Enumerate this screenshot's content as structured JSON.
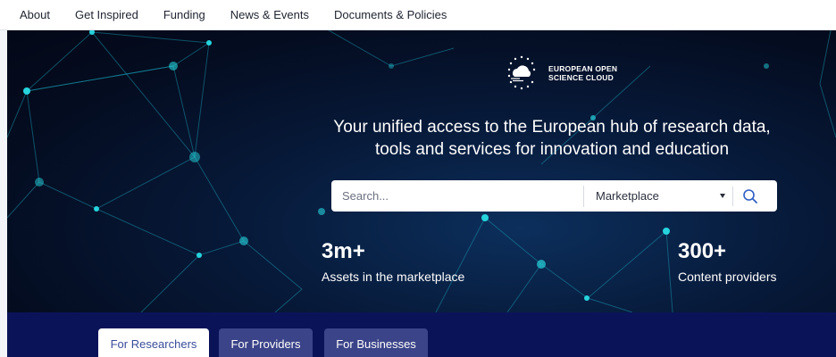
{
  "nav": {
    "items": [
      "About",
      "Get Inspired",
      "Funding",
      "News & Events",
      "Documents & Policies"
    ]
  },
  "logo": {
    "line1": "EUROPEAN OPEN",
    "line2": "SCIENCE CLOUD"
  },
  "hero": {
    "headline_line1": "Your unified access to the European hub of research data,",
    "headline_line2": "tools and services for innovation and education"
  },
  "search": {
    "placeholder": "Search...",
    "scope_selected": "Marketplace",
    "search_icon": "search-icon"
  },
  "stats": [
    {
      "value": "3m+",
      "label": "Assets in the marketplace"
    },
    {
      "value": "300+",
      "label": "Content providers"
    }
  ],
  "tabs": [
    {
      "label": "For Researchers",
      "active": true
    },
    {
      "label": "For Providers",
      "active": false
    },
    {
      "label": "For Businesses",
      "active": false
    }
  ],
  "colors": {
    "hero_bg": "#040c20",
    "network_node": "#1fc7d4",
    "band_bg": "#0b1358",
    "tab_inactive": "#3b4488",
    "tab_active_text": "#3a4d9a"
  }
}
